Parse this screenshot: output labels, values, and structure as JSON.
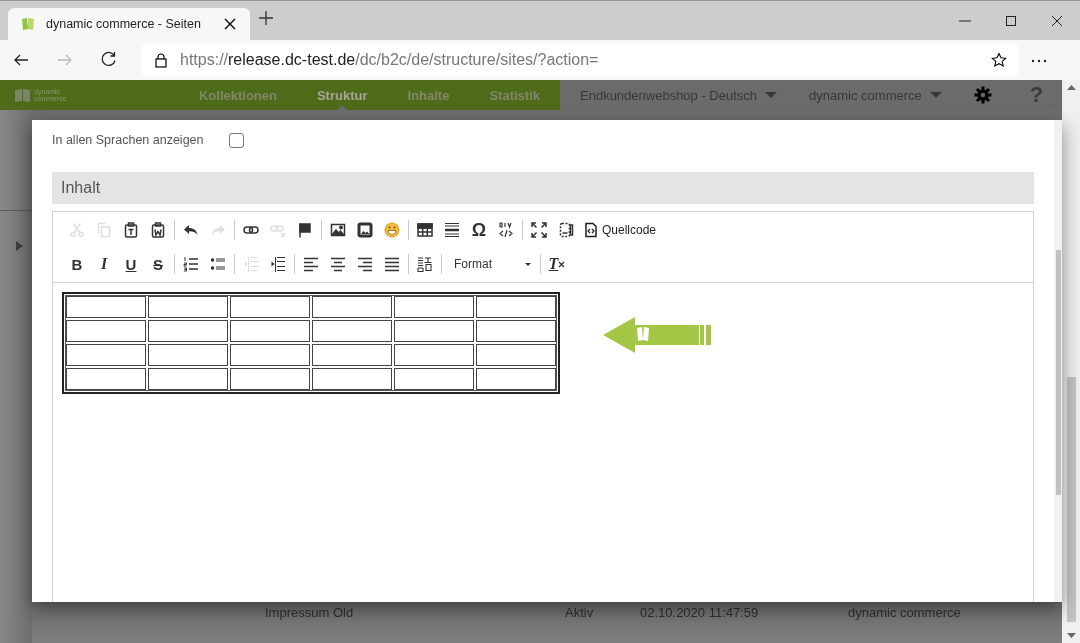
{
  "browser": {
    "tab_title": "dynamic commerce - Seiten",
    "address": {
      "scheme": "https://",
      "host": "release.dc-test.de",
      "path": "/dc/b2c/de/structure/sites/?action="
    },
    "forward_disabled": true
  },
  "nav": {
    "logo_text": [
      "dynamic",
      "commerce"
    ],
    "items": [
      {
        "label": "Kollektionen",
        "selected": false
      },
      {
        "label": "Struktur",
        "selected": true
      },
      {
        "label": "Inhalte",
        "selected": false
      },
      {
        "label": "Statistik",
        "selected": false
      }
    ],
    "dropdowns": [
      "Endkundenwebshop - Deutsch",
      "dynamic commerce"
    ],
    "help": "?"
  },
  "background_row": [
    "Impressum Old",
    "Aktiv",
    "02.10.2020 11:47:59",
    "dynamic commerce"
  ],
  "dialog": {
    "checkbox": {
      "label": "In allen Sprachen anzeigen",
      "checked": false
    },
    "section_title": "Inhalt",
    "toolbar": [
      [
        [
          {
            "kind": "icon",
            "disabled": true
          },
          {
            "kind": "icon",
            "disabled": true
          },
          {
            "kind": "icon",
            "disabled": false
          },
          {
            "kind": "icon",
            "disabled": false
          }
        ],
        [
          {
            "kind": "icon",
            "disabled": false
          },
          {
            "kind": "icon",
            "disabled": true
          }
        ],
        [
          {
            "kind": "icon",
            "disabled": false
          },
          {
            "kind": "icon",
            "disabled": true
          },
          {
            "kind": "icon",
            "disabled": false
          }
        ],
        [
          {
            "kind": "icon",
            "disabled": false
          },
          {
            "kind": "icon",
            "disabled": false
          },
          {
            "kind": "icon",
            "disabled": false
          }
        ],
        [
          {
            "kind": "icon",
            "disabled": false
          },
          {
            "kind": "icon",
            "disabled": false
          },
          {
            "kind": "glyph",
            "label": "Ω",
            "disabled": false
          },
          {
            "kind": "icon",
            "disabled": false
          }
        ],
        [
          {
            "kind": "icon",
            "disabled": false
          },
          {
            "kind": "icon",
            "disabled": false
          },
          {
            "kind": "text",
            "label": "Quellcode",
            "disabled": false
          }
        ]
      ],
      [
        [
          {
            "kind": "bold",
            "label": "B",
            "disabled": false
          },
          {
            "kind": "italic",
            "label": "I",
            "disabled": false
          },
          {
            "kind": "underline",
            "label": "U",
            "disabled": false
          },
          {
            "kind": "strike",
            "label": "S",
            "disabled": false
          }
        ],
        [
          {
            "kind": "icon",
            "disabled": false
          },
          {
            "kind": "icon",
            "disabled": false
          }
        ],
        [
          {
            "kind": "icon",
            "disabled": true
          },
          {
            "kind": "icon",
            "disabled": false
          }
        ],
        [
          {
            "kind": "icon",
            "disabled": false
          },
          {
            "kind": "icon",
            "disabled": false
          },
          {
            "kind": "icon",
            "disabled": false
          },
          {
            "kind": "icon",
            "disabled": false
          }
        ],
        [
          {
            "kind": "icon",
            "disabled": false
          }
        ],
        [
          {
            "kind": "dropdown",
            "label": "Format",
            "disabled": false
          }
        ],
        [
          {
            "kind": "clear",
            "label": "T",
            "disabled": false
          }
        ]
      ]
    ]
  }
}
